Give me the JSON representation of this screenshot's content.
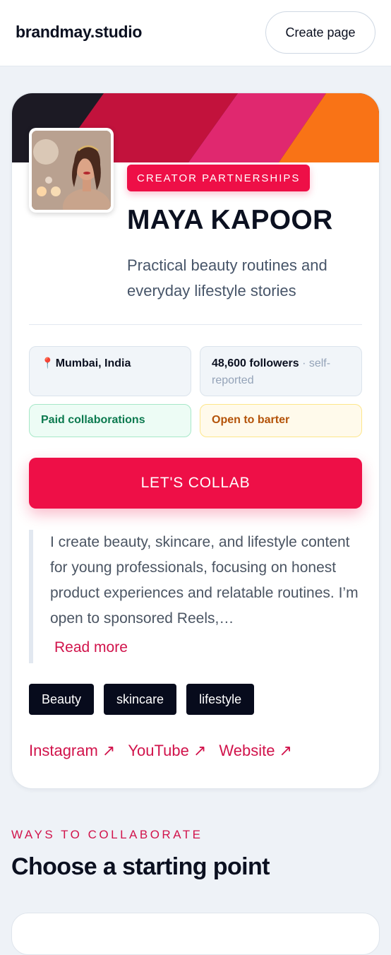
{
  "header": {
    "brand": "brandmay.studio",
    "create_label": "Create page"
  },
  "profile": {
    "badge": "CREATOR PARTNERSHIPS",
    "name": "MAYA KAPOOR",
    "tagline": "Practical beauty routines and everyday lifestyle stories",
    "location": "Mumbai, India",
    "followers": "48,600 followers",
    "followers_note": "· self-reported",
    "paid": "Paid collaborations",
    "barter": "Open to barter",
    "cta": "LET'S COLLAB",
    "bio": "I create beauty, skincare, and lifestyle content for young professionals, focusing on honest product experiences and relatable routines. I’m open to sponsored Reels,…",
    "read_more": "Read more",
    "tags": [
      "Beauty",
      "skincare",
      "lifestyle"
    ],
    "links": [
      "Instagram ↗",
      "YouTube ↗",
      "Website ↗"
    ]
  },
  "section": {
    "kicker": "WAYS TO COLLABORATE",
    "title": "Choose a starting point"
  },
  "colors": {
    "accent": "#ee0f47",
    "banner": [
      "#1c1a24",
      "#c2123c",
      "#e0286f",
      "#f97316"
    ]
  },
  "icons": {
    "location": "map-pin-icon",
    "external": "arrow-up-right-icon"
  }
}
